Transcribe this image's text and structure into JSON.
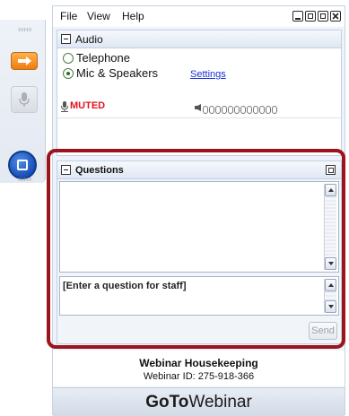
{
  "menu": {
    "file": "File",
    "view": "View",
    "help": "Help"
  },
  "audio": {
    "title": "Audio",
    "option_telephone": "Telephone",
    "option_mic": "Mic & Speakers",
    "settings_link": "Settings",
    "selected_option": "Mic & Speakers",
    "status": "MUTED",
    "input_level": 0.0
  },
  "questions": {
    "title": "Questions",
    "input_placeholder": "[Enter a question for staff]",
    "send_label": "Send"
  },
  "webinar": {
    "title": "Webinar Housekeeping",
    "id_line": "Webinar ID: 275-918-366"
  },
  "brand": {
    "goto": "GoTo",
    "webinar": "Webinar"
  },
  "colors": {
    "highlight": "#9b141b",
    "muted": "#e0141e",
    "link": "#1a2fd6",
    "accent_orange": "#ee7d12",
    "accent_blue": "#1a4fb5"
  }
}
